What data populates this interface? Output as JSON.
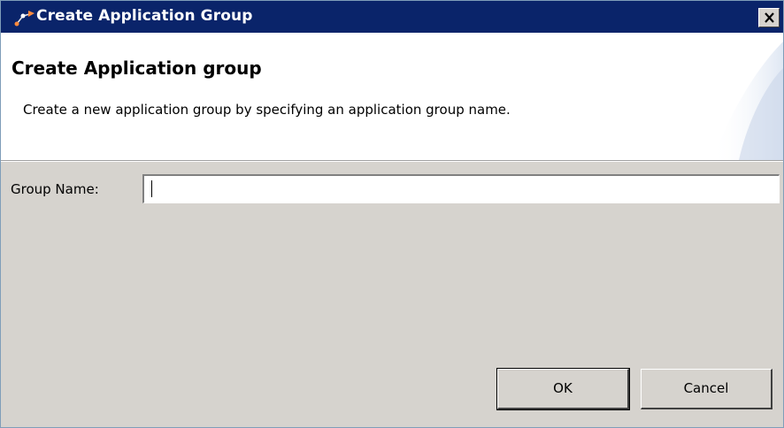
{
  "window": {
    "title": "Create Application Group"
  },
  "banner": {
    "heading": "Create Application group",
    "description": "Create a new application group by specifying an application group name."
  },
  "form": {
    "group_name_label": "Group Name:",
    "group_name_value": ""
  },
  "buttons": {
    "ok_label": "OK",
    "cancel_label": "Cancel"
  },
  "colors": {
    "titlebar": "#0a246a",
    "dialog_background": "#d6d3ce",
    "banner_background": "#ffffff"
  },
  "icons": {
    "app": "app-group-icon",
    "close": "close-icon"
  }
}
